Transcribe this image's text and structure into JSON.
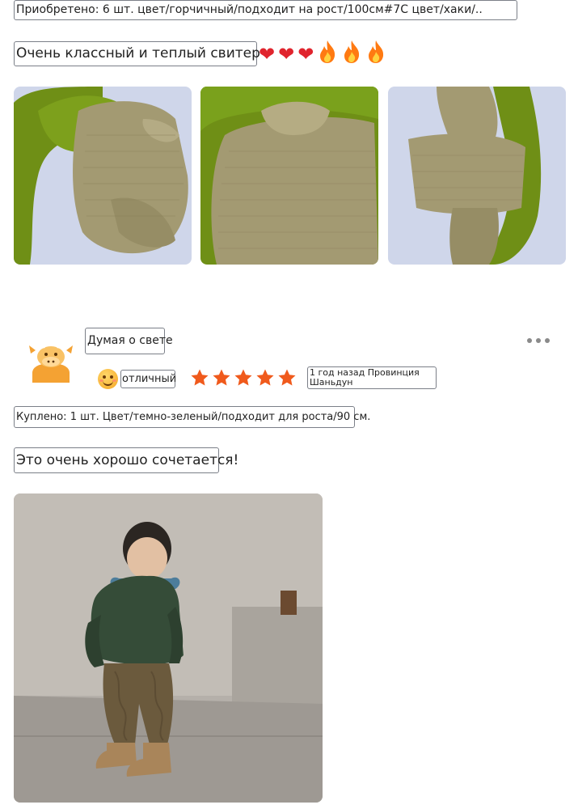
{
  "review_1": {
    "purchase_info": "Приобретено: 6 шт. цвет/горчичный/подходит на рост/100см#7C цвет/хаки/..",
    "text": "Очень классный и теплый свитер",
    "emojis": [
      "❤️",
      "❤️",
      "❤️",
      "🔥",
      "🔥",
      "🔥"
    ],
    "photo_count": 3
  },
  "review_2": {
    "reviewer_name": "Думая о свете",
    "rating_label": "отличный",
    "stars": 5,
    "meta": "1 год назад Провинция Шаньдун",
    "purchase_info": "Куплено: 1 шт. Цвет/темно-зеленый/подходит для роста/90 см.",
    "text": "Это очень хорошо сочетается!"
  },
  "icons": {
    "more": "more-horizontal-icon",
    "star": "star-icon",
    "avatar": "cow-avatar-icon",
    "rating": "smile-emoji-icon"
  },
  "colors": {
    "star": "#f05a1c",
    "heart": "#e0242d",
    "fire": "#ff7a12",
    "sweater_khaki": "#a39a72",
    "sweater_green": "#6f8f16",
    "sweater_darkgreen": "#3a4f3a"
  }
}
